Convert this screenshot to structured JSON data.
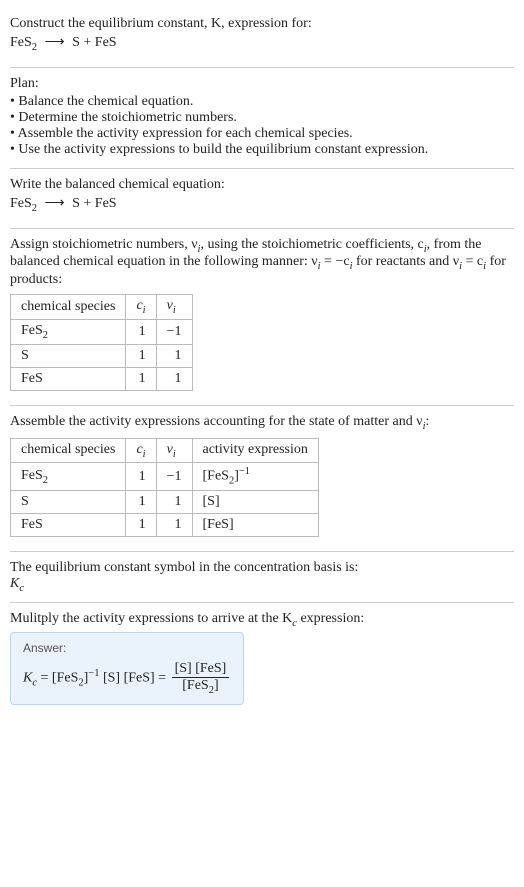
{
  "header": {
    "prompt_line1": "Construct the equilibrium constant, K, expression for:",
    "reaction_lhs": "FeS",
    "reaction_lhs_sub": "2",
    "reaction_arrow": "⟶",
    "reaction_rhs": "S + FeS"
  },
  "plan": {
    "title": "Plan:",
    "items": [
      "• Balance the chemical equation.",
      "• Determine the stoichiometric numbers.",
      "• Assemble the activity expression for each chemical species.",
      "• Use the activity expressions to build the equilibrium constant expression."
    ]
  },
  "balanced": {
    "intro": "Write the balanced chemical equation:",
    "reaction_lhs": "FeS",
    "reaction_lhs_sub": "2",
    "reaction_arrow": "⟶",
    "reaction_rhs": "S + FeS"
  },
  "stoich": {
    "intro_a": "Assign stoichiometric numbers, ν",
    "intro_a_sub": "i",
    "intro_b": ", using the stoichiometric coefficients, c",
    "intro_b_sub": "i",
    "intro_c": ", from the balanced chemical equation in the following manner: ν",
    "intro_c_sub": "i",
    "intro_d": " = −c",
    "intro_d_sub": "i",
    "intro_e": " for reactants and ν",
    "intro_e_sub": "i",
    "intro_f": " = c",
    "intro_f_sub": "i",
    "intro_g": " for products:",
    "headers": {
      "species": "chemical species",
      "c": "c",
      "c_sub": "i",
      "nu": "ν",
      "nu_sub": "i"
    },
    "rows": [
      {
        "species_a": "FeS",
        "species_sub": "2",
        "species_b": "",
        "c": "1",
        "nu": "−1"
      },
      {
        "species_a": "S",
        "species_sub": "",
        "species_b": "",
        "c": "1",
        "nu": "1"
      },
      {
        "species_a": "FeS",
        "species_sub": "",
        "species_b": "",
        "c": "1",
        "nu": "1"
      }
    ]
  },
  "activity": {
    "intro_a": "Assemble the activity expressions accounting for the state of matter and ν",
    "intro_sub": "i",
    "intro_b": ":",
    "headers": {
      "species": "chemical species",
      "c": "c",
      "c_sub": "i",
      "nu": "ν",
      "nu_sub": "i",
      "expr": "activity expression"
    },
    "rows": [
      {
        "species_a": "FeS",
        "species_sub": "2",
        "c": "1",
        "nu": "−1",
        "expr_a": "[FeS",
        "expr_sub": "2",
        "expr_b": "]",
        "expr_sup": "−1"
      },
      {
        "species_a": "S",
        "species_sub": "",
        "c": "1",
        "nu": "1",
        "expr_a": "[S]",
        "expr_sub": "",
        "expr_b": "",
        "expr_sup": ""
      },
      {
        "species_a": "FeS",
        "species_sub": "",
        "c": "1",
        "nu": "1",
        "expr_a": "[FeS]",
        "expr_sub": "",
        "expr_b": "",
        "expr_sup": ""
      }
    ]
  },
  "basis": {
    "line": "The equilibrium constant symbol in the concentration basis is:",
    "symbol": "K",
    "symbol_sub": "c"
  },
  "multiply": {
    "line_a": "Mulitply the activity expressions to arrive at the K",
    "line_sub": "c",
    "line_b": " expression:"
  },
  "answer": {
    "label": "Answer:",
    "k": "K",
    "k_sub": "c",
    "eq1a": " = [FeS",
    "eq1_sub": "2",
    "eq1b": "]",
    "eq1_sup": "−1",
    "eq1c": " [S] [FeS] = ",
    "frac_num": "[S] [FeS]",
    "frac_den_a": "[FeS",
    "frac_den_sub": "2",
    "frac_den_b": "]"
  }
}
